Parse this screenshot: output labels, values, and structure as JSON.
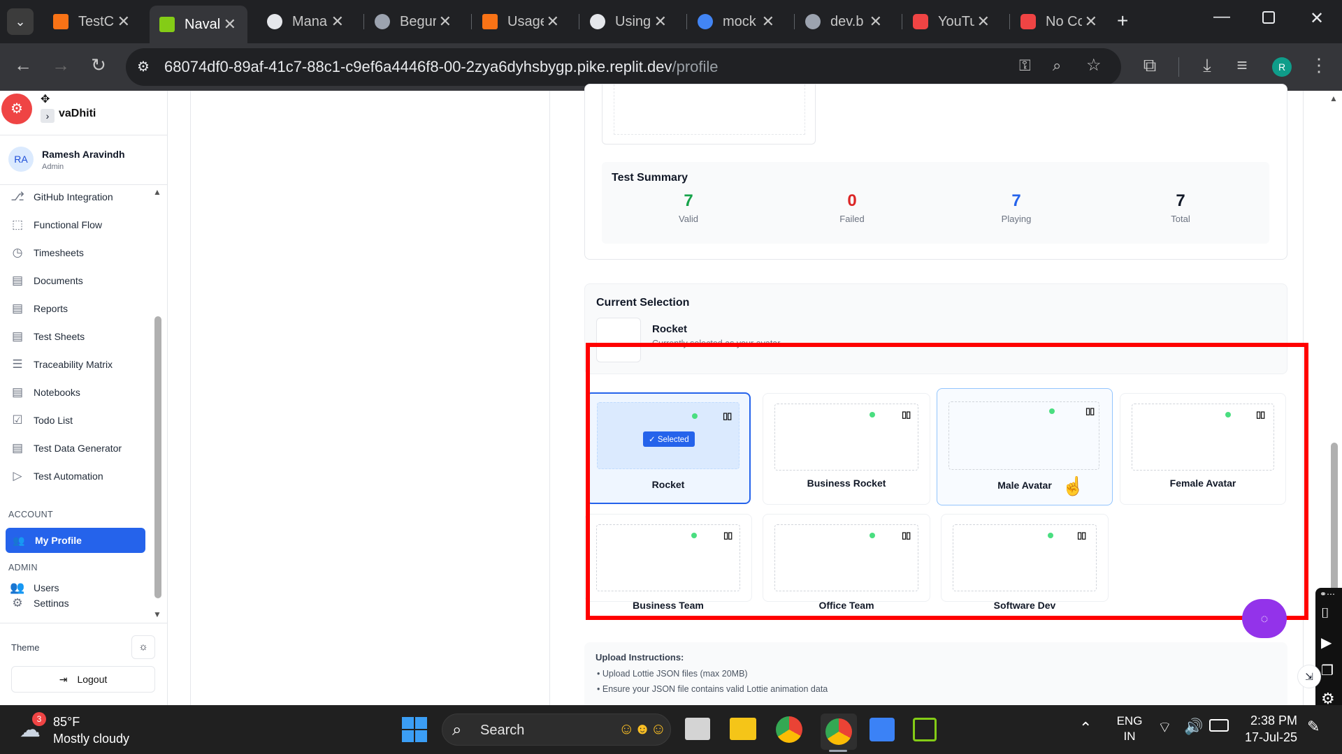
{
  "browser": {
    "tabs": [
      {
        "title": "TestCa",
        "favicon_color": "#f97316"
      },
      {
        "title": "Naval",
        "favicon_color": "#84cc16"
      },
      {
        "title": "Mana",
        "favicon_color": "#e5e7eb"
      },
      {
        "title": "Begur",
        "favicon_color": "#9ca3af"
      },
      {
        "title": "Usage",
        "favicon_color": "#f97316"
      },
      {
        "title": "Using",
        "favicon_color": "#e5e7eb"
      },
      {
        "title": "mock",
        "favicon_color": "#4285f4"
      },
      {
        "title": "dev.b",
        "favicon_color": "#9ca3af"
      },
      {
        "title": "YouTu",
        "favicon_color": "#ef4444"
      },
      {
        "title": "No Co",
        "favicon_color": "#ef4444"
      }
    ],
    "url_host": "68074df0-89af-41c7-88c1-c9ef6a4446f8-00-2zya6dyhsbygp.pike.replit.dev",
    "url_path": "/profile",
    "profile_initial": "R"
  },
  "sidebar": {
    "brand": "vaDhiti",
    "user": {
      "initials": "RA",
      "name": "Ramesh Aravindh",
      "role": "Admin"
    },
    "items": [
      {
        "label": "GitHub Integration",
        "icon": "github-icon",
        "glyph": "⎇"
      },
      {
        "label": "Functional Flow",
        "icon": "flow-icon",
        "glyph": "⬚"
      },
      {
        "label": "Timesheets",
        "icon": "clock-icon",
        "glyph": "◷"
      },
      {
        "label": "Documents",
        "icon": "document-icon",
        "glyph": "▤"
      },
      {
        "label": "Reports",
        "icon": "report-icon",
        "glyph": "▤"
      },
      {
        "label": "Test Sheets",
        "icon": "sheet-icon",
        "glyph": "▤"
      },
      {
        "label": "Traceability Matrix",
        "icon": "filter-icon",
        "glyph": "☰"
      },
      {
        "label": "Notebooks",
        "icon": "notebook-icon",
        "glyph": "▤"
      },
      {
        "label": "Todo List",
        "icon": "checkbox-icon",
        "glyph": "☑"
      },
      {
        "label": "Test Data Generator",
        "icon": "generator-icon",
        "glyph": "▤"
      },
      {
        "label": "Test Automation",
        "icon": "play-icon",
        "glyph": "▷"
      }
    ],
    "account_label": "ACCOUNT",
    "my_profile": "My Profile",
    "admin_label": "ADMIN",
    "users": "Users",
    "settings": "Settings",
    "theme_label": "Theme",
    "logout": "Logout"
  },
  "main": {
    "test_summary": {
      "title": "Test Summary",
      "stats": [
        {
          "value": "7",
          "label": "Valid",
          "color": "#16a34a"
        },
        {
          "value": "0",
          "label": "Failed",
          "color": "#dc2626"
        },
        {
          "value": "7",
          "label": "Playing",
          "color": "#2563eb"
        },
        {
          "value": "7",
          "label": "Total",
          "color": "#111827"
        }
      ]
    },
    "current_selection": {
      "title": "Current Selection",
      "name": "Rocket",
      "subtitle": "Currently selected as your avatar"
    },
    "avatars": [
      {
        "name": "Rocket",
        "selected": true
      },
      {
        "name": "Business Rocket",
        "selected": false
      },
      {
        "name": "Male Avatar",
        "selected": false
      },
      {
        "name": "Female Avatar",
        "selected": false
      },
      {
        "name": "Business Team",
        "selected": false
      },
      {
        "name": "Office Team",
        "selected": false
      },
      {
        "name": "Software Dev",
        "selected": false
      }
    ],
    "selected_badge": "✓ Selected",
    "pause_glyph": "▯▯",
    "upload": {
      "title": "Upload Instructions:",
      "items": [
        "Upload Lottie JSON files (max 20MB)",
        "Ensure your JSON file contains valid Lottie animation data"
      ]
    }
  },
  "taskbar": {
    "weather_badge": "3",
    "temperature": "85°F",
    "condition": "Mostly cloudy",
    "search": "Search",
    "lang1": "ENG",
    "lang2": "IN",
    "time": "2:38 PM",
    "date": "17-Jul-25"
  },
  "colors": {
    "accent": "#2563eb",
    "highlight_box": "#ff0000",
    "chat_bubble": "#9333ea"
  }
}
